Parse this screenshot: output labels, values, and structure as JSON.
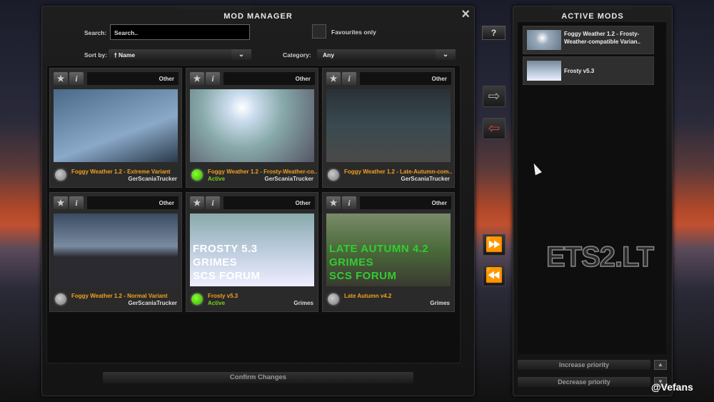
{
  "mod_manager": {
    "title": "MOD MANAGER",
    "close_icon": "×",
    "search_label": "Search:",
    "search_value": "Search..",
    "favourites_label": "Favourites only",
    "sort_label": "Sort by:",
    "sort_value": "🠕 Name",
    "category_label": "Category:",
    "category_value": "Any",
    "confirm_label": "Confirm Changes",
    "help_label": "?"
  },
  "mods": [
    {
      "name": "Foggy Weather 1.2 - Extreme Variant",
      "author": "GerScaniaTrucker",
      "category": "Other",
      "status": "",
      "active": false,
      "thumb_text": []
    },
    {
      "name": "Foggy Weather 1.2 - Frosty-Weather-co..",
      "author": "GerScaniaTrucker",
      "category": "Other",
      "status": "Active",
      "active": true,
      "thumb_text": []
    },
    {
      "name": "Foggy Weather 1.2 - Late-Autumn-com..",
      "author": "GerScaniaTrucker",
      "category": "Other",
      "status": "",
      "active": false,
      "thumb_text": []
    },
    {
      "name": "Foggy Weather 1.2 - Normal Variant",
      "author": "GerScaniaTrucker",
      "category": "Other",
      "status": "",
      "active": false,
      "thumb_text": []
    },
    {
      "name": "Frosty v5.3",
      "author": "Grimes",
      "category": "Other",
      "status": "Active",
      "active": true,
      "thumb_text": [
        "FROSTY 5.3",
        "GRIMES",
        "SCS FORUM"
      ]
    },
    {
      "name": "Late Autumn v4.2",
      "author": "Grimes",
      "category": "Other",
      "status": "",
      "active": false,
      "thumb_text": [
        "LATE AUTUMN 4.2",
        "GRIMES",
        "SCS FORUM"
      ]
    }
  ],
  "active_mods": {
    "title": "ACTIVE MODS",
    "items": [
      {
        "name": "Foggy Weather 1.2 - Frosty-Weather-compatible Varian.."
      },
      {
        "name": "Frosty v5.3"
      }
    ],
    "increase_label": "Increase priority",
    "decrease_label": "Decrease priority"
  },
  "watermark": "ETS2.LT",
  "credit": "@Vefans"
}
